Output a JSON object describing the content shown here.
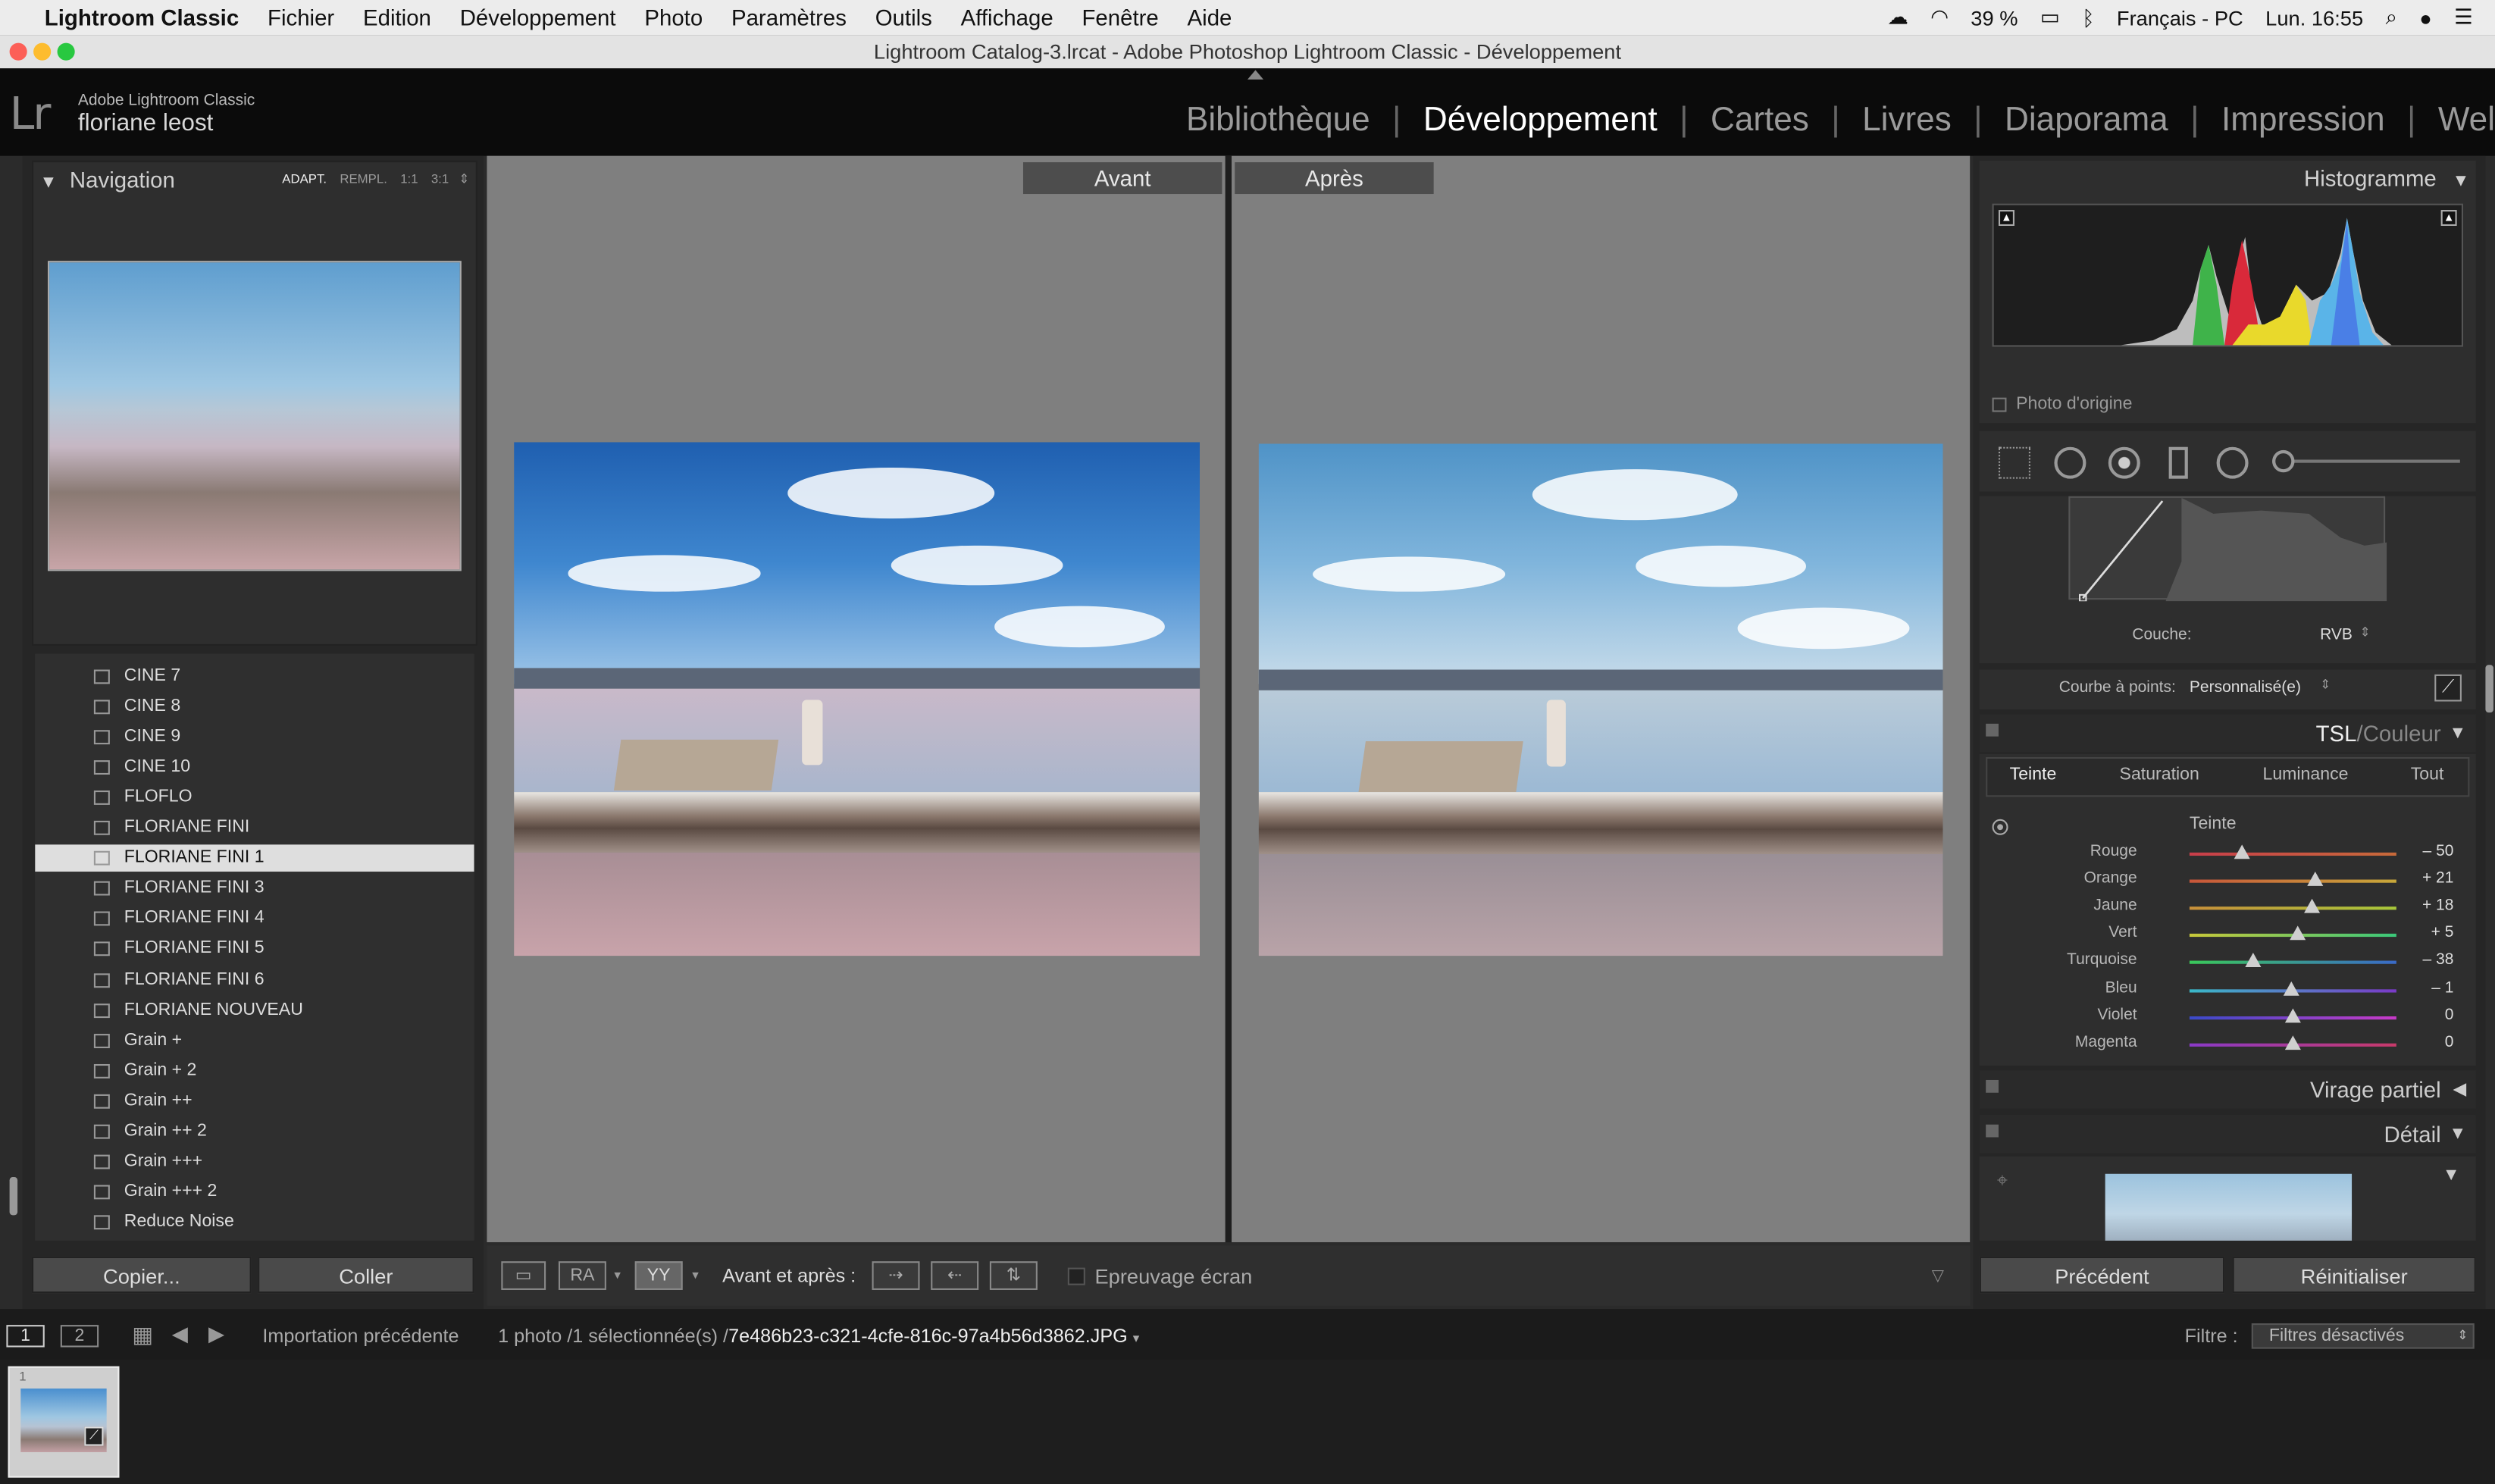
{
  "menubar": {
    "app_name": "Lightroom Classic",
    "items": [
      "Fichier",
      "Edition",
      "Développement",
      "Photo",
      "Paramètres",
      "Outils",
      "Affichage",
      "Fenêtre",
      "Aide"
    ],
    "battery": "39 %",
    "input_source": "Français - PC",
    "clock": "Lun. 16:55"
  },
  "window": {
    "title": "Lightroom Catalog-3.lrcat - Adobe Photoshop Lightroom Classic - Développement"
  },
  "identity": {
    "logo": "Lr",
    "product": "Adobe Lightroom Classic",
    "user": "floriane leost"
  },
  "modules": {
    "items": [
      "Bibliothèque",
      "Développement",
      "Cartes",
      "Livres",
      "Diaporama",
      "Impression",
      "Wel"
    ],
    "active": "Développement"
  },
  "navigator": {
    "title": "Navigation",
    "zoom_options": [
      "ADAPT.",
      "REMPL.",
      "1:1",
      "3:1"
    ]
  },
  "presets": {
    "items": [
      "CINE 7",
      "CINE 8",
      "CINE 9",
      "CINE 10",
      "FLOFLO",
      "FLORIANE FINI",
      "FLORIANE FINI 1",
      "FLORIANE FINI 3",
      "FLORIANE FINI 4",
      "FLORIANE FINI 5",
      "FLORIANE FINI 6",
      "FLORIANE NOUVEAU",
      "Grain +",
      "Grain + 2",
      "Grain ++",
      "Grain ++ 2",
      "Grain +++",
      "Grain +++ 2",
      "Reduce Noise"
    ],
    "selected": "FLORIANE FINI 1"
  },
  "left_buttons": {
    "copy": "Copier...",
    "paste": "Coller"
  },
  "compare": {
    "before_label": "Avant",
    "after_label": "Après"
  },
  "toolbar": {
    "view_ra": "RA",
    "view_yy": "YY",
    "before_after_label": "Avant et après :",
    "softproof_label": "Epreuvage écran"
  },
  "histogram": {
    "title": "Histogramme",
    "original_photo_label": "Photo d'origine"
  },
  "tone_curve": {
    "channel_label": "Couche:",
    "channel_value": "RVB",
    "point_curve_label": "Courbe à points:",
    "point_curve_value": "Personnalisé(e)"
  },
  "hsl": {
    "title_main": "TSL",
    "title_alt": "Couleur",
    "tabs": [
      "Teinte",
      "Saturation",
      "Luminance",
      "Tout"
    ],
    "active_tab": "Teinte",
    "group_label": "Teinte",
    "sliders": [
      {
        "label": "Rouge",
        "value": "– 50",
        "num": -50
      },
      {
        "label": "Orange",
        "value": "+ 21",
        "num": 21
      },
      {
        "label": "Jaune",
        "value": "+ 18",
        "num": 18
      },
      {
        "label": "Vert",
        "value": "+ 5",
        "num": 5
      },
      {
        "label": "Turquoise",
        "value": "– 38",
        "num": -38
      },
      {
        "label": "Bleu",
        "value": "– 1",
        "num": -1
      },
      {
        "label": "Violet",
        "value": "0",
        "num": 0
      },
      {
        "label": "Magenta",
        "value": "0",
        "num": 0
      }
    ]
  },
  "sections": {
    "split_toning": "Virage partiel",
    "detail": "Détail"
  },
  "right_buttons": {
    "previous": "Précédent",
    "reset": "Réinitialiser"
  },
  "filmstrip": {
    "screen1": "1",
    "screen2": "2",
    "source": "Importation précédente",
    "count": "1 photo /1 sélectionnée(s) /",
    "filename": "7e486b23-c321-4cfe-816c-97a4b56d3862.JPG",
    "filter_label": "Filtre :",
    "filter_value": "Filtres désactivés",
    "thumb_index": "1"
  }
}
